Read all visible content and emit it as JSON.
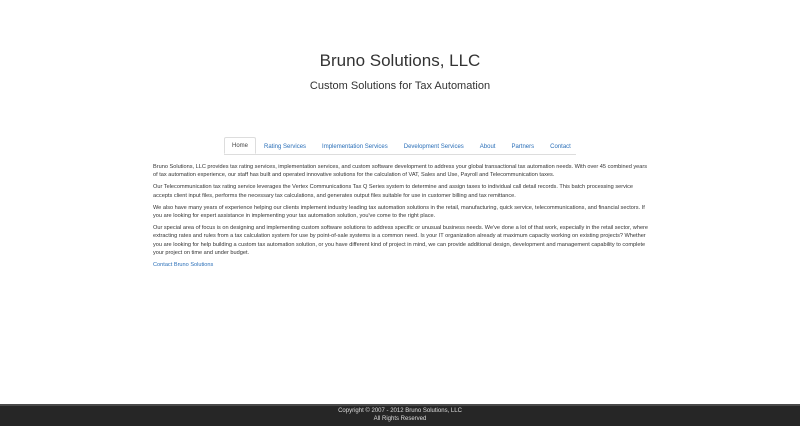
{
  "header": {
    "title": "Bruno Solutions, LLC",
    "subtitle": "Custom Solutions for Tax Automation"
  },
  "nav": {
    "items": [
      {
        "label": "Home"
      },
      {
        "label": "Rating Services"
      },
      {
        "label": "Implementation Services"
      },
      {
        "label": "Development Services"
      },
      {
        "label": "About"
      },
      {
        "label": "Partners"
      },
      {
        "label": "Contact"
      }
    ],
    "active": "Home"
  },
  "content": {
    "paragraphs": [
      "Bruno Solutions, LLC provides tax rating services, implementation services, and custom software development to address your global transactional tax automation needs. With over 45 combined years of tax automation experience, our staff has built and operated innovative solutions for the calculation of VAT, Sales and Use, Payroll and Telecommunication taxes.",
      "Our Telecommunication tax rating service leverages the Vertex Communications Tax Q Series system to determine and assign taxes to individual call detail records. This batch processing service accepts client input files, performs the necessary tax calculations, and generates output files suitable for use in customer billing and tax remittance.",
      "We also have many years of experience helping our clients implement industry leading tax automation solutions in the retail, manufacturing, quick service, telecommunications, and financial sectors. If you are looking for expert assistance in implementing your tax automation solution, you've come to the right place.",
      "Our special area of focus is on designing and implementing custom software solutions to address specific or unusual business needs. We've done a lot of that work, especially in the retail sector, where extracting rates and rules from a tax calculation system for use by point-of-sale systems is a common need. Is your IT organization already at maximum capacity working on existing projects? Whether you are looking for help building a custom tax automation solution, or you have different kind of project in mind, we can provide additional design, development and management capability to complete your project on time and under budget."
    ],
    "contact_link": "Contact Bruno Solutions"
  },
  "footer": {
    "copyright": "Copyright © 2007 - 2012 Bruno Solutions, LLC",
    "rights": "All Rights Reserved"
  },
  "colors": {
    "link": "#2a6fb8",
    "footer_bg": "#262626",
    "text": "#333333"
  }
}
